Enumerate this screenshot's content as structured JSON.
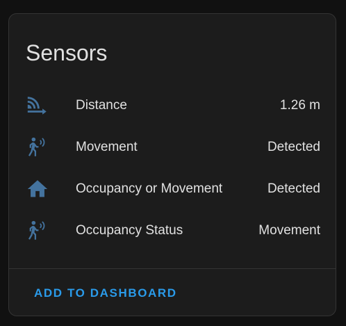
{
  "card": {
    "title": "Sensors",
    "action_label": "ADD TO DASHBOARD",
    "icon_color": "#44739e",
    "accent_color": "#2a9bea"
  },
  "sensors": [
    {
      "icon": "signal-distance-icon",
      "label": "Distance",
      "value": "1.26 m"
    },
    {
      "icon": "motion-sensor-icon",
      "label": "Movement",
      "value": "Detected"
    },
    {
      "icon": "home-icon",
      "label": "Occupancy or Movement",
      "value": "Detected"
    },
    {
      "icon": "motion-sensor-icon",
      "label": "Occupancy Status",
      "value": "Movement"
    }
  ]
}
